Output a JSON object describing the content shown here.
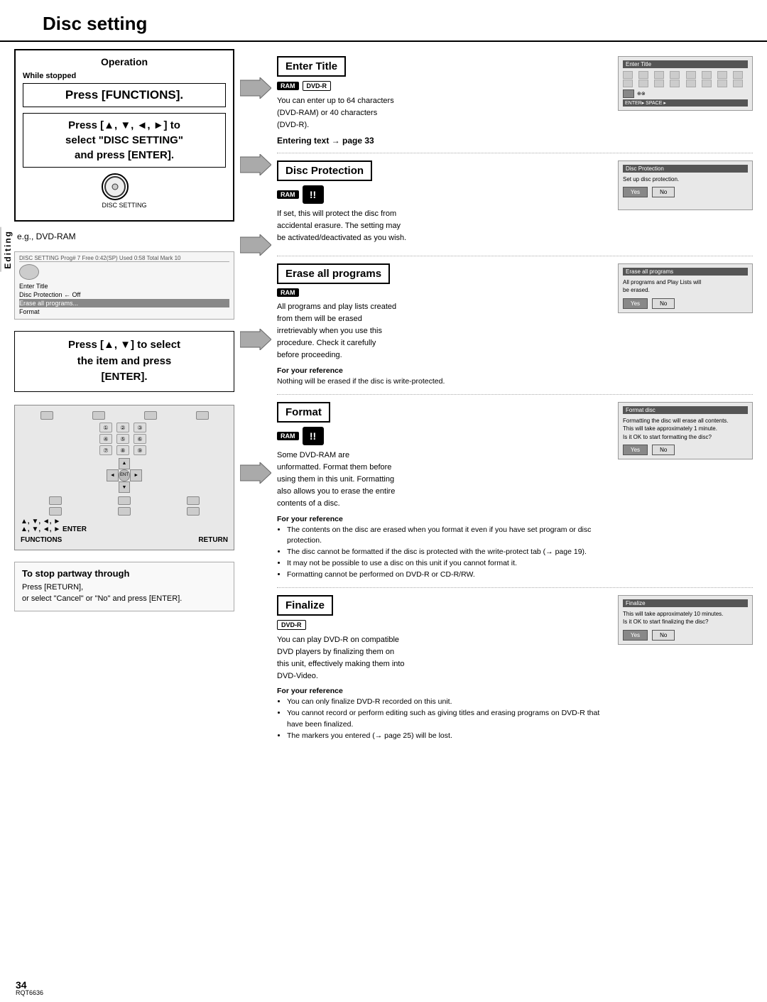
{
  "page": {
    "title": "Disc setting",
    "page_number": "34",
    "model_number": "RQT6636",
    "editing_label": "Editing"
  },
  "left_col": {
    "operation_title": "Operation",
    "while_stopped": "While stopped",
    "press_functions": "Press [FUNCTIONS].",
    "press_nav": "Press [▲, ▼, ◄, ►] to\nselect \"DISC SETTING\"\nand press [ENTER].",
    "disc_setting_label": "DISC SETTING",
    "eg_label": "e.g., DVD-RAM",
    "press_arrows": "Press [▲, ▼] to select\nthe item and press\n[ENTER].",
    "enter_label": "▲, ▼, ◄, ►\nENTER",
    "functions_label": "FUNCTIONS",
    "return_label": "RETURN",
    "stop_title": "To stop partway through",
    "stop_text1": "Press [RETURN],",
    "stop_text2": "or select \"Cancel\" or \"No\" and press\n[ENTER].",
    "menu_items": [
      {
        "label": "Enter Title",
        "selected": false
      },
      {
        "label": "Disc Protection    ← Off",
        "selected": false
      },
      {
        "label": "Erase all programs...",
        "selected": true
      },
      {
        "label": "Format",
        "selected": false
      }
    ]
  },
  "sections": [
    {
      "id": "enter-title",
      "header": "Enter Title",
      "badges": [
        "RAM",
        "DVD-R"
      ],
      "body": "You can enter up to 64 characters\n(DVD-RAM) or 40 characters\n(DVD-R).",
      "link": "Entering text → page 33",
      "for_ref": null,
      "ss_title": "Enter Title",
      "ss_type": "grid"
    },
    {
      "id": "disc-protection",
      "header": "Disc Protection",
      "badges": [
        "RAM"
      ],
      "has_warning": true,
      "body": "If set, this will protect the disc from\naccidental erasure. The setting may\nbe activated/deactivated as you wish.",
      "link": null,
      "for_ref": null,
      "ss_title": "Disc Protection",
      "ss_text": "Set up disc protection.",
      "ss_buttons": [
        "Yes",
        "No"
      ]
    },
    {
      "id": "erase-all-programs",
      "header": "Erase all programs",
      "badges": [
        "RAM"
      ],
      "has_warning": false,
      "body": "All programs and play lists created\nfrom them will be erased\nirretrievably when you use this\nprocedure. Check it carefully\nbefore proceeding.",
      "for_ref_title": "For your reference",
      "for_ref_text": "Nothing will be erased if the disc is write-protected.",
      "ss_title": "Erase all programs",
      "ss_text": "All programs and Play Lists will\nbe erased.",
      "ss_buttons": [
        "Yes",
        "No"
      ]
    },
    {
      "id": "format",
      "header": "Format",
      "badges": [
        "RAM"
      ],
      "has_warning": true,
      "body": "Some DVD-RAM are\nunformatted. Format them before\nusing them in this unit. Formatting\nalso allows you to erase the entire\ncontents of a disc.",
      "for_ref_title": "For your reference",
      "for_ref_items": [
        "The contents on the disc are erased when you format it even if you have set\nprogram or disc protection.",
        "The disc cannot be formatted if the disc is protected with the write-protect\ntab (→ page 19).",
        "It may not be possible to use a disc on this unit if you cannot format it.",
        "Formatting cannot be performed on DVD-R or CD-R/RW."
      ],
      "ss_title": "Format disc",
      "ss_text": "Formatting the disc will erase all contents.\nThis will take approximately 1 minute.\nIs it OK to start formatting the disc?",
      "ss_buttons": [
        "Yes",
        "No"
      ]
    },
    {
      "id": "finalize",
      "header": "Finalize",
      "badges": [
        "DVD-R"
      ],
      "has_warning": false,
      "body": "You can play DVD-R on compatible\nDVD players by finalizing them on\nthis unit, effectively making them into\nDVD-Video.",
      "for_ref_title": "For your reference",
      "for_ref_items": [
        "You can only finalize DVD-R recorded on this unit.",
        "You cannot record or perform editing such as giving titles and\nerasing programs on DVD-R that have been finalized.",
        "The markers you entered (→ page 25) will be lost."
      ],
      "ss_title": "Finalize",
      "ss_text": "This will take approximately 10 minutes.\nIs it OK to start finalizing the disc?",
      "ss_buttons": [
        "Yes",
        "No"
      ]
    }
  ]
}
